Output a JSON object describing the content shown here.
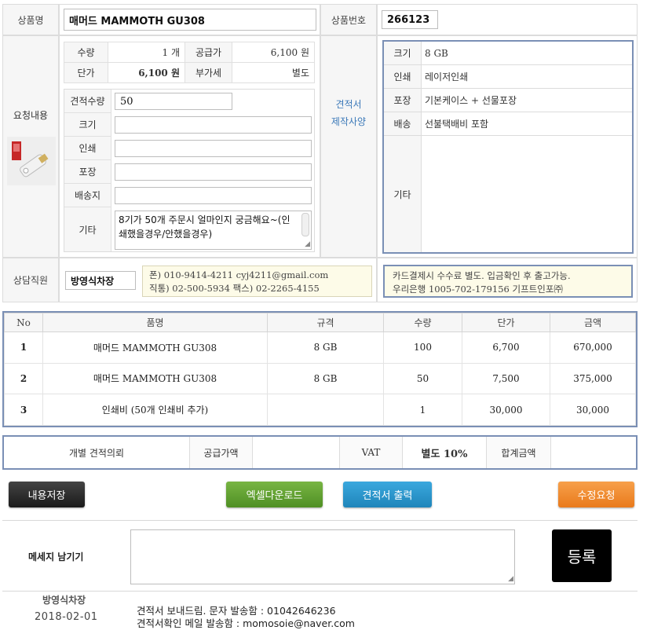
{
  "product": {
    "name_label": "상품명",
    "name_value": "매머드 MAMMOTH GU308",
    "number_label": "상품번호",
    "number_value": "266123"
  },
  "request": {
    "label": "요청내용",
    "price_table": {
      "qty_label": "수량",
      "qty_value": "1 개",
      "supply_label": "공급가",
      "supply_value": "6,100 원",
      "unit_label": "단가",
      "unit_value": "6,100 원",
      "vat_label": "부가세",
      "vat_value": "별도"
    },
    "form": {
      "quote_qty_label": "견적수량",
      "quote_qty_value": "50",
      "size_label": "크기",
      "print_label": "인쇄",
      "pack_label": "포장",
      "ship_label": "배송지",
      "etc_label": "기타",
      "etc_value": "8기가 50개 주문시 얼마인지 궁금해요~(인쇄했을경우/안했을경우)"
    }
  },
  "spec": {
    "title_line1": "견적서",
    "title_line2": "제작사양",
    "rows": [
      {
        "key": "크기",
        "value": "8 GB"
      },
      {
        "key": "인쇄",
        "value": "레이저인쇄"
      },
      {
        "key": "포장",
        "value": "기본케이스 + 선물포장"
      },
      {
        "key": "배송",
        "value": "선불택배비 포함"
      }
    ],
    "etc_key": "기타"
  },
  "consultant": {
    "label": "상담직원",
    "name": "방영식차장",
    "contact_line1": "폰) 010-9414-4211 cyj4211@gmail.com",
    "contact_line2": "직통) 02-500-5934 팩스) 02-2265-4155",
    "notice_line1": "카드결제시 수수료 별도. 입금확인 후 출고가능.",
    "notice_line2": "우리은행 1005-702-179156 기프트인포㈜"
  },
  "items": {
    "headers": [
      "No",
      "품명",
      "규격",
      "수량",
      "단가",
      "금액"
    ],
    "rows": [
      {
        "no": "1",
        "name": "매머드 MAMMOTH GU308",
        "spec": "8 GB",
        "qty": "100",
        "unit": "6,700",
        "amount": "670,000"
      },
      {
        "no": "2",
        "name": "매머드 MAMMOTH GU308",
        "spec": "8 GB",
        "qty": "50",
        "unit": "7,500",
        "amount": "375,000"
      },
      {
        "no": "3",
        "name": "인쇄비 (50개 인쇄비 추가)",
        "spec": "",
        "qty": "1",
        "unit": "30,000",
        "amount": "30,000"
      }
    ]
  },
  "totals": {
    "individual": "개별 견적의뢰",
    "supply_label": "공급가액",
    "supply_value": "",
    "vat_label": "VAT",
    "vat_value": "별도 10%",
    "sum_label": "합계금액",
    "sum_value": ""
  },
  "buttons": {
    "save": "내용저장",
    "excel": "엑셀다운로드",
    "print": "견적서 출력",
    "edit": "수정요청"
  },
  "message": {
    "label": "메세지 남기기",
    "register": "등록"
  },
  "log": {
    "name": "방영식차장",
    "date": "2018-02-01",
    "line1": "견적서 보내드림. 문자 발송함 : 01042646236",
    "line2": "견적서확인 메일 발송함 : momosoie@naver.com"
  },
  "colors": {
    "accent_border": "#7a8fb5",
    "btn_save": "#2b2b2b",
    "btn_excel": "#5a9a2a",
    "btn_print": "#2a94c9",
    "btn_edit": "#f0862a",
    "spec_title": "#3a78b8"
  }
}
